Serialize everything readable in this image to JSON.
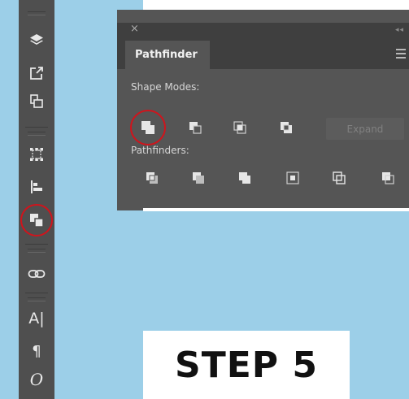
{
  "panel": {
    "close_glyph": "×",
    "collapse_glyph": "◂◂",
    "tab_label": "Pathfinder",
    "shape_modes_label": "Shape Modes:",
    "pathfinders_label": "Pathfinders:",
    "expand_label": "Expand",
    "shape_modes": [
      "unite-icon",
      "minus-front-icon",
      "intersect-icon",
      "exclude-icon"
    ],
    "pathfinders": [
      "divide-icon",
      "trim-icon",
      "merge-icon",
      "crop-icon",
      "outline-icon",
      "minus-back-icon"
    ]
  },
  "toolbar": {
    "tools": [
      "layers-icon",
      "export-icon",
      "artboards-icon",
      "transform-icon",
      "align-icon",
      "pathfinder-icon",
      "links-icon",
      "character-icon",
      "paragraph-icon",
      "opentype-icon"
    ],
    "text_glyphs": {
      "character": "A|",
      "paragraph": "¶",
      "opentype": "O"
    }
  },
  "step": {
    "label": "STEP 5"
  },
  "colors": {
    "background": "#9ccfe8",
    "toolbar": "#4f4f4f",
    "panel": "#555555",
    "highlight": "#d0141c"
  }
}
